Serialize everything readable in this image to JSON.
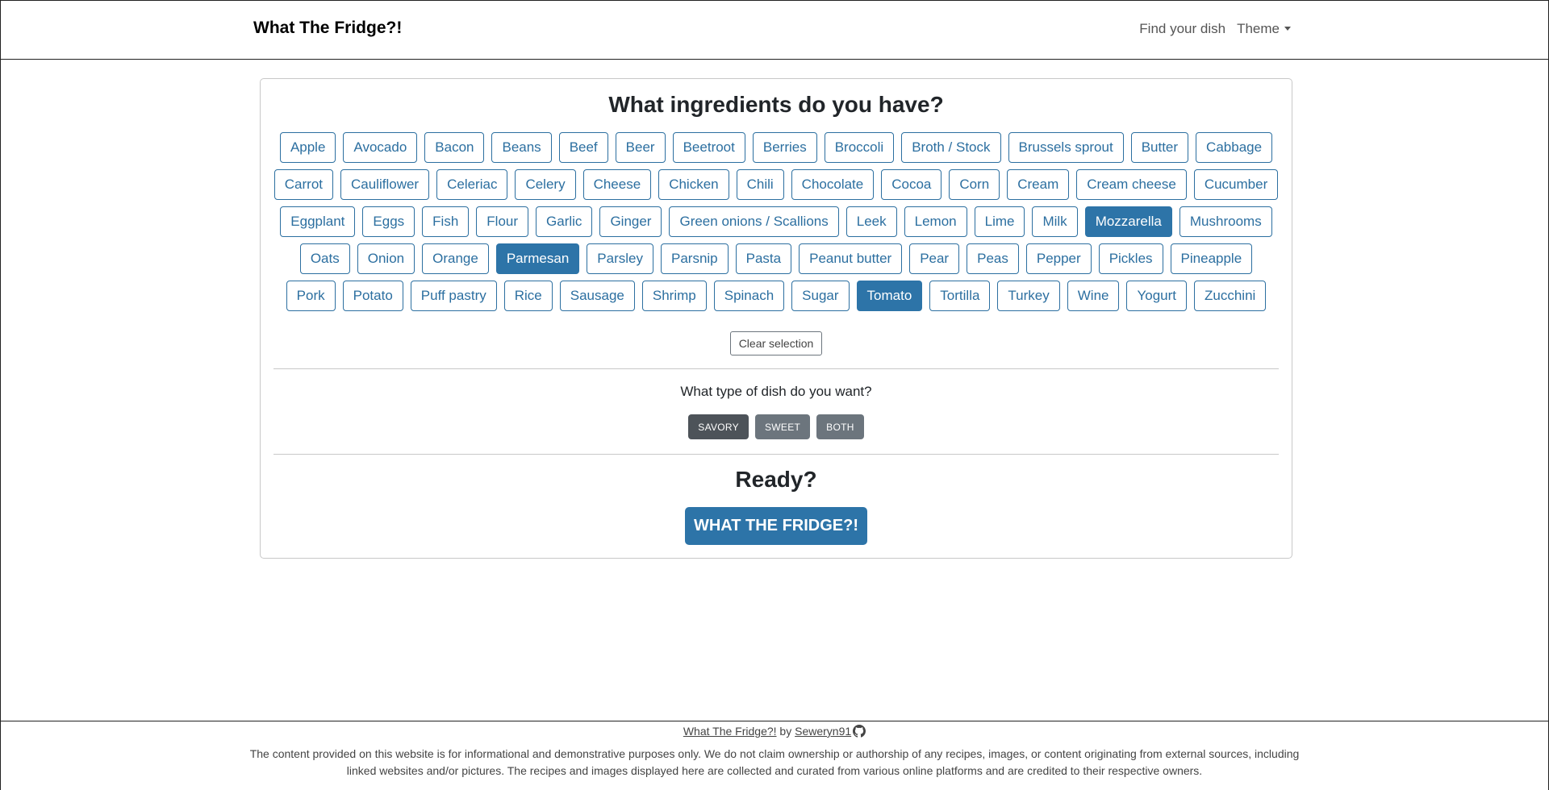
{
  "navbar": {
    "brand": "What The Fridge?!",
    "find_dish": "Find your dish",
    "theme": "Theme"
  },
  "main": {
    "heading": "What ingredients do you have?",
    "ingredients": [
      {
        "label": "Apple",
        "selected": false
      },
      {
        "label": "Avocado",
        "selected": false
      },
      {
        "label": "Bacon",
        "selected": false
      },
      {
        "label": "Beans",
        "selected": false
      },
      {
        "label": "Beef",
        "selected": false
      },
      {
        "label": "Beer",
        "selected": false
      },
      {
        "label": "Beetroot",
        "selected": false
      },
      {
        "label": "Berries",
        "selected": false
      },
      {
        "label": "Broccoli",
        "selected": false
      },
      {
        "label": "Broth / Stock",
        "selected": false
      },
      {
        "label": "Brussels sprout",
        "selected": false
      },
      {
        "label": "Butter",
        "selected": false
      },
      {
        "label": "Cabbage",
        "selected": false
      },
      {
        "label": "Carrot",
        "selected": false
      },
      {
        "label": "Cauliflower",
        "selected": false
      },
      {
        "label": "Celeriac",
        "selected": false
      },
      {
        "label": "Celery",
        "selected": false
      },
      {
        "label": "Cheese",
        "selected": false
      },
      {
        "label": "Chicken",
        "selected": false
      },
      {
        "label": "Chili",
        "selected": false
      },
      {
        "label": "Chocolate",
        "selected": false
      },
      {
        "label": "Cocoa",
        "selected": false
      },
      {
        "label": "Corn",
        "selected": false
      },
      {
        "label": "Cream",
        "selected": false
      },
      {
        "label": "Cream cheese",
        "selected": false
      },
      {
        "label": "Cucumber",
        "selected": false
      },
      {
        "label": "Eggplant",
        "selected": false
      },
      {
        "label": "Eggs",
        "selected": false
      },
      {
        "label": "Fish",
        "selected": false
      },
      {
        "label": "Flour",
        "selected": false
      },
      {
        "label": "Garlic",
        "selected": false
      },
      {
        "label": "Ginger",
        "selected": false
      },
      {
        "label": "Green onions / Scallions",
        "selected": false
      },
      {
        "label": "Leek",
        "selected": false
      },
      {
        "label": "Lemon",
        "selected": false
      },
      {
        "label": "Lime",
        "selected": false
      },
      {
        "label": "Milk",
        "selected": false
      },
      {
        "label": "Mozzarella",
        "selected": true
      },
      {
        "label": "Mushrooms",
        "selected": false
      },
      {
        "label": "Oats",
        "selected": false
      },
      {
        "label": "Onion",
        "selected": false
      },
      {
        "label": "Orange",
        "selected": false
      },
      {
        "label": "Parmesan",
        "selected": true
      },
      {
        "label": "Parsley",
        "selected": false
      },
      {
        "label": "Parsnip",
        "selected": false
      },
      {
        "label": "Pasta",
        "selected": false
      },
      {
        "label": "Peanut butter",
        "selected": false
      },
      {
        "label": "Pear",
        "selected": false
      },
      {
        "label": "Peas",
        "selected": false
      },
      {
        "label": "Pepper",
        "selected": false
      },
      {
        "label": "Pickles",
        "selected": false
      },
      {
        "label": "Pineapple",
        "selected": false
      },
      {
        "label": "Pork",
        "selected": false
      },
      {
        "label": "Potato",
        "selected": false
      },
      {
        "label": "Puff pastry",
        "selected": false
      },
      {
        "label": "Rice",
        "selected": false
      },
      {
        "label": "Sausage",
        "selected": false
      },
      {
        "label": "Shrimp",
        "selected": false
      },
      {
        "label": "Spinach",
        "selected": false
      },
      {
        "label": "Sugar",
        "selected": false
      },
      {
        "label": "Tomato",
        "selected": true
      },
      {
        "label": "Tortilla",
        "selected": false
      },
      {
        "label": "Turkey",
        "selected": false
      },
      {
        "label": "Wine",
        "selected": false
      },
      {
        "label": "Yogurt",
        "selected": false
      },
      {
        "label": "Zucchini",
        "selected": false
      }
    ],
    "clear_label": "Clear selection",
    "dish_question": "What type of dish do you want?",
    "dish_types": [
      {
        "label": "SAVORY",
        "active": true
      },
      {
        "label": "SWEET",
        "active": false
      },
      {
        "label": "BOTH",
        "active": false
      }
    ],
    "ready_label": "Ready?",
    "go_label": "WHAT THE FRIDGE?!"
  },
  "footer": {
    "site_link": "What The Fridge?!",
    "by": "by",
    "author": "Seweryn91",
    "author_icon": "github-icon",
    "disclaimer": "The content provided on this website is for informational and demonstrative purposes only. We do not claim ownership or authorship of any recipes, images, or content originating from external sources, including linked websites and/or pictures. The recipes and images displayed here are collected and curated from various online platforms and are credited to their respective owners."
  },
  "colors": {
    "primary": "#2d74a8",
    "secondary": "#6c757d",
    "secondary_active": "#4d5359"
  }
}
